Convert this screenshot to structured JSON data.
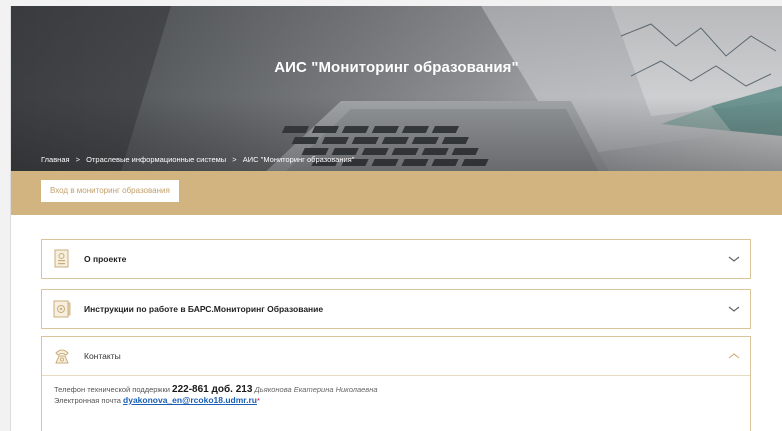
{
  "hero": {
    "title": "АИС \"Мониторинг образования\""
  },
  "breadcrumb": {
    "items": [
      "Главная",
      "Отраслевые информационные системы",
      "АИС \"Мониторинг образования\""
    ],
    "separator": ">"
  },
  "band": {
    "login_label": "Вход в мониторинг образования"
  },
  "accordion": {
    "items": [
      {
        "title": "О проекте",
        "state": "collapsed"
      },
      {
        "title": "Инструкции по работе в БАРС.Мониторинг Образование",
        "state": "collapsed"
      },
      {
        "title": "Контакты",
        "state": "expanded"
      }
    ]
  },
  "contacts": {
    "phone_label": "Телефон технической поддержки",
    "phone_number": "222-861 доб. 213",
    "person": "Дьяконова Екатерина Николаевна",
    "email_label": "Электронная почта",
    "email": "dyakonova_en@rcoko18.udmr.ru",
    "email_suffix": "*"
  },
  "colors": {
    "gold": "#d1b47f",
    "border": "#d8c49b",
    "link": "#1a5fb4"
  }
}
